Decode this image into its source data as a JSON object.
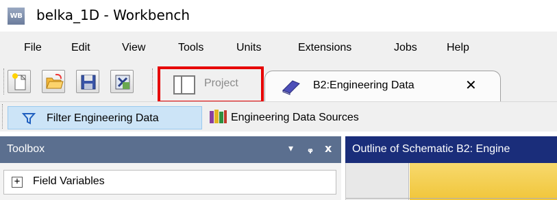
{
  "window": {
    "app_icon_text": "WB",
    "title": "belka_1D - Workbench"
  },
  "menubar": {
    "items": [
      "File",
      "Edit",
      "View",
      "Tools",
      "Units",
      "Extensions",
      "Jobs",
      "Help"
    ]
  },
  "toolbar": {
    "buttons": [
      "new-icon",
      "open-icon",
      "save-icon",
      "import-icon"
    ]
  },
  "tabs": {
    "project_label": "Project",
    "active_label": "B2:Engineering Data",
    "close_glyph": "✕"
  },
  "filterbar": {
    "filter_label": "Filter Engineering Data",
    "sources_label": "Engineering Data Sources"
  },
  "toolbox": {
    "title": "Toolbox",
    "dropdown_glyph": "▾",
    "pin_glyph": "ᵖ",
    "close_glyph": "x",
    "expander_glyph": "+",
    "first_item": "Field Variables"
  },
  "outline": {
    "title": "Outline of Schematic B2: Engine"
  },
  "colors": {
    "highlight": "#e60000",
    "toolbox_header": "#5b6f8f",
    "outline_header": "#1a2d7a",
    "filter_active": "#cce4f7",
    "outline_colhead": "#f1c63a"
  }
}
